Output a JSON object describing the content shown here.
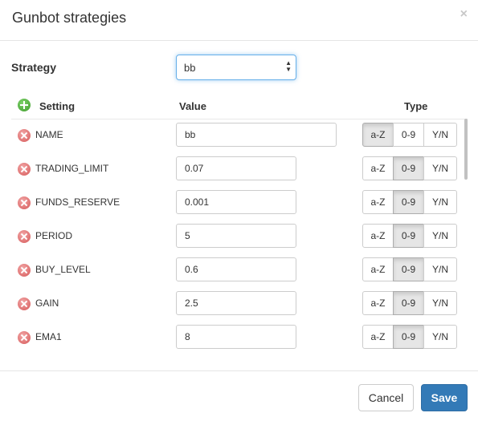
{
  "modal": {
    "title": "Gunbot strategies",
    "close_glyph": "×"
  },
  "strategy": {
    "label": "Strategy",
    "selected": "bb"
  },
  "table": {
    "headers": {
      "setting": "Setting",
      "value": "Value",
      "type": "Type"
    },
    "type_options": [
      "a-Z",
      "0-9",
      "Y/N"
    ],
    "rows": [
      {
        "name": "NAME",
        "value": "bb",
        "type": "a-Z"
      },
      {
        "name": "TRADING_LIMIT",
        "value": "0.07",
        "type": "0-9"
      },
      {
        "name": "FUNDS_RESERVE",
        "value": "0.001",
        "type": "0-9"
      },
      {
        "name": "PERIOD",
        "value": "5",
        "type": "0-9"
      },
      {
        "name": "BUY_LEVEL",
        "value": "0.6",
        "type": "0-9"
      },
      {
        "name": "GAIN",
        "value": "2.5",
        "type": "0-9"
      },
      {
        "name": "EMA1",
        "value": "8",
        "type": "0-9"
      }
    ]
  },
  "icons": {
    "add": "add-circle-icon",
    "delete": "remove-circle-icon",
    "close": "close-icon",
    "select_arrows": "sort-arrows-icon"
  },
  "footer": {
    "cancel_label": "Cancel",
    "save_label": "Save"
  },
  "colors": {
    "primary": "#337ab7",
    "add_icon": "#4cae3a",
    "delete_icon": "#d9534f",
    "focus": "#66afe9"
  }
}
